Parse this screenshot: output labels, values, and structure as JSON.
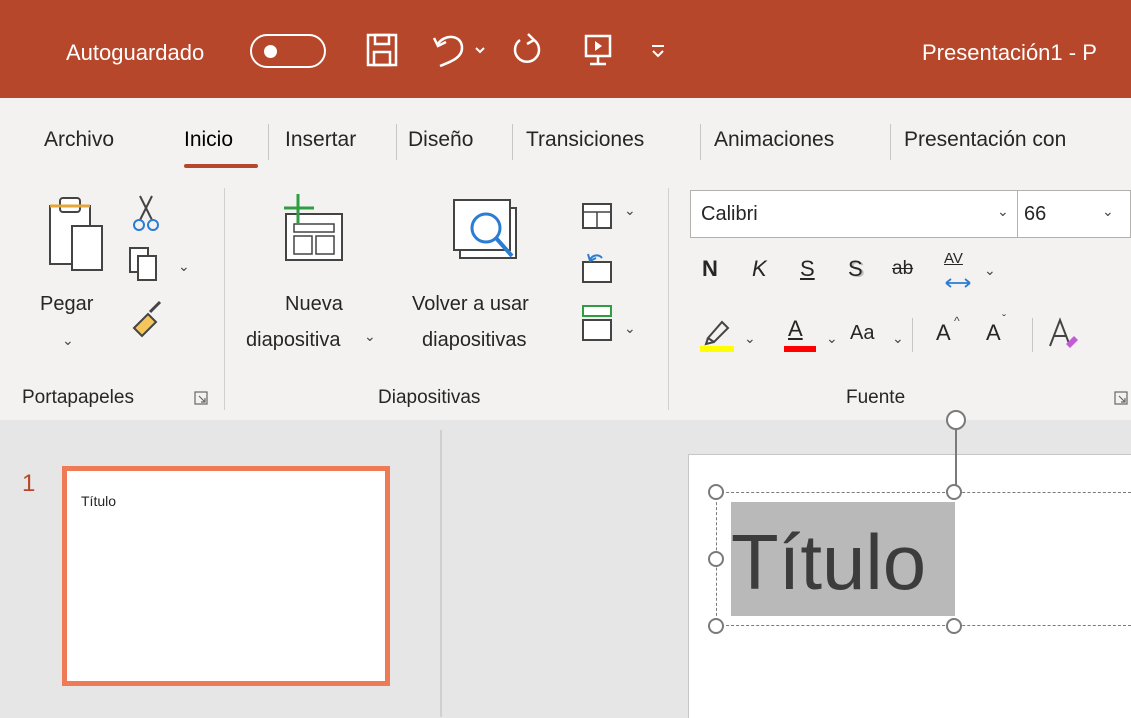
{
  "titlebar": {
    "autosave_label": "Autoguardado",
    "doc_title": "Presentación1  -  P",
    "background": "#b7472a"
  },
  "tabs": [
    {
      "label": "Archivo"
    },
    {
      "label": "Inicio"
    },
    {
      "label": "Insertar"
    },
    {
      "label": "Diseño"
    },
    {
      "label": "Transiciones"
    },
    {
      "label": "Animaciones"
    },
    {
      "label": "Presentación con"
    }
  ],
  "ribbon": {
    "portapapeles": {
      "paste_label": "Pegar",
      "group_label": "Portapapeles"
    },
    "diapositivas": {
      "new_slide_line1": "Nueva",
      "new_slide_line2": "diapositiva",
      "reuse_line1": "Volver a usar",
      "reuse_line2": "diapositivas",
      "group_label": "Diapositivas"
    },
    "fuente": {
      "font_name": "Calibri",
      "font_size": "66",
      "bold": "N",
      "italic": "K",
      "underline": "S",
      "shadow": "S",
      "strike": "ab",
      "spacing": "AV",
      "font_color_letter": "A",
      "change_case": "Aa",
      "grow": "A",
      "shrink": "A",
      "group_label": "Fuente"
    }
  },
  "slides": [
    {
      "number": "1",
      "title": "Título"
    }
  ],
  "canvas": {
    "title_text": "Título"
  },
  "colors": {
    "accent": "#b7472a",
    "thumb_border": "#ef7b56",
    "highlight_yellow": "#ffff00",
    "font_red": "#ff0000"
  }
}
